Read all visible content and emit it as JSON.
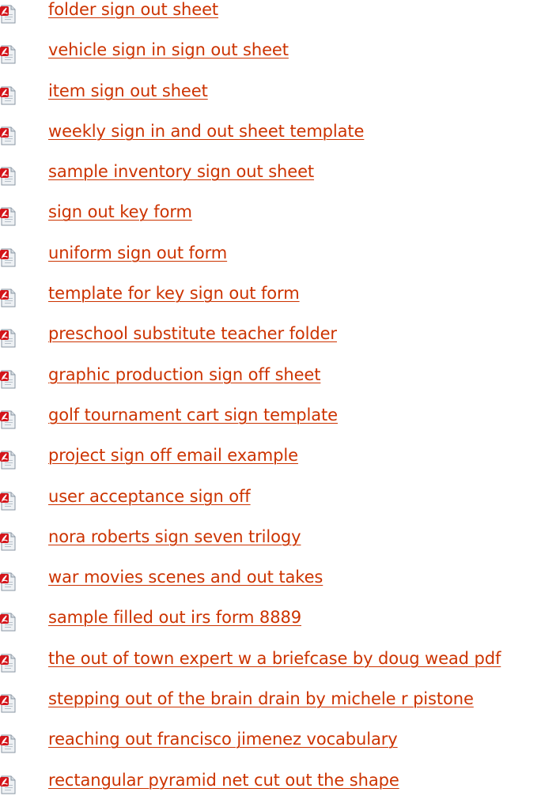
{
  "colors": {
    "link": "#cc3300",
    "icon_red": "#d4151b",
    "icon_paper": "#eef1f4"
  },
  "icon": "pdf-file-icon",
  "links": [
    {
      "label": "folder sign out sheet"
    },
    {
      "label": "vehicle sign in sign out sheet"
    },
    {
      "label": "item sign out sheet"
    },
    {
      "label": "weekly sign in and out sheet template"
    },
    {
      "label": "sample inventory sign out sheet"
    },
    {
      "label": "sign out key form"
    },
    {
      "label": "uniform sign out form"
    },
    {
      "label": "template for key sign out form"
    },
    {
      "label": "preschool substitute teacher folder"
    },
    {
      "label": "graphic production sign off sheet"
    },
    {
      "label": "golf tournament cart sign template"
    },
    {
      "label": "project sign off email example"
    },
    {
      "label": "user acceptance sign off"
    },
    {
      "label": "nora roberts sign seven trilogy"
    },
    {
      "label": "war movies scenes and out takes"
    },
    {
      "label": "sample filled out irs form 8889"
    },
    {
      "label": "the out of town expert w a briefcase by doug wead pdf"
    },
    {
      "label": "stepping out of the brain drain by michele r pistone"
    },
    {
      "label": "reaching out francisco jimenez vocabulary"
    },
    {
      "label": "rectangular pyramid net cut out the shape"
    }
  ]
}
